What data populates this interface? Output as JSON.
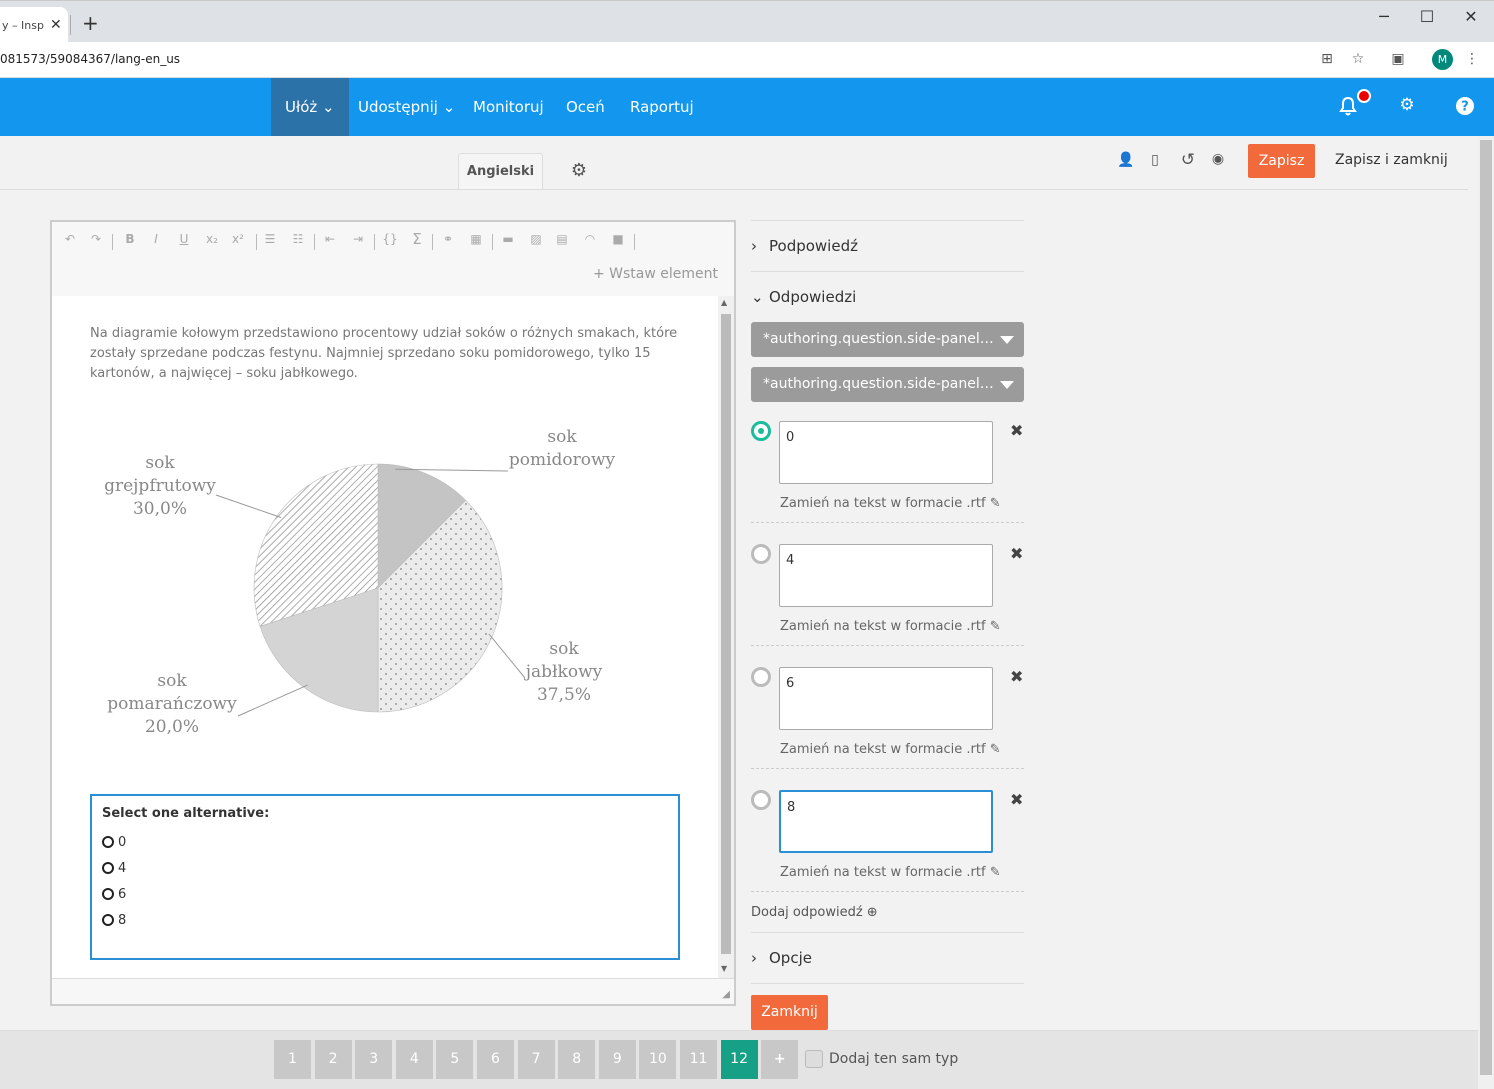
{
  "browser": {
    "tab_title": "y – Inspe",
    "url": "081573/59084367/lang-en_us",
    "avatar_letter": "M"
  },
  "nav": {
    "items": [
      {
        "label": "Ułóż ⌄"
      },
      {
        "label": "Udostępnij ⌄"
      },
      {
        "label": "Monitoruj"
      },
      {
        "label": "Oceń"
      },
      {
        "label": "Raportuj"
      }
    ]
  },
  "toolbar": {
    "language_tab": "Angielski",
    "save_label": "Zapisz",
    "save_close_label": "Zapisz i zamknij"
  },
  "editor": {
    "insert_element": "Wstaw element",
    "question_text": "Na diagramie kołowym przedstawiono procentowy udział soków o różnych smakach, które zostały sprzedane podczas festynu. Najmniej sprzedano soku pomidorowego, tylko 15 kartonów, a najwięcej – soku jabłkowego.",
    "alternatives_title": "Select one alternative:",
    "alternatives": [
      "0",
      "4",
      "6",
      "8"
    ]
  },
  "chart_data": {
    "type": "pie",
    "slices": [
      {
        "label_lines": [
          "sok",
          "pomidorowy"
        ],
        "value": 12.5,
        "pattern": "solid-light-gray"
      },
      {
        "label_lines": [
          "sok",
          "jabłkowy",
          "37,5%"
        ],
        "value": 37.5,
        "pattern": "dotted"
      },
      {
        "label_lines": [
          "sok",
          "pomarańczowy",
          "20,0%"
        ],
        "value": 20.0,
        "pattern": "solid-gray"
      },
      {
        "label_lines": [
          "sok",
          "grejpfrutowy",
          "30,0%"
        ],
        "value": 30.0,
        "pattern": "hatched"
      }
    ]
  },
  "panel": {
    "hint_label": "Podpowiedź",
    "answers_label": "Odpowiedzi",
    "dropdown1": "*authoring.question.side-panel.t...",
    "dropdown2": "*authoring.question.side-panel....",
    "answers": [
      {
        "value": "0",
        "selected": true
      },
      {
        "value": "4",
        "selected": false
      },
      {
        "value": "6",
        "selected": false
      },
      {
        "value": "8",
        "selected": false
      }
    ],
    "rtf_label": "Zamień na tekst w formacie .rtf",
    "add_answer": "Dodaj odpowiedź",
    "options_label": "Opcje",
    "close_label": "Zamknij"
  },
  "pager": {
    "pages": [
      "1",
      "2",
      "3",
      "4",
      "5",
      "6",
      "7",
      "8",
      "9",
      "10",
      "11",
      "12"
    ],
    "active_page": "12",
    "add_symbol": "+",
    "same_type_label": "Dodaj ten sam typ"
  },
  "colors": {
    "nav_blue": "#1296ee",
    "nav_active": "#2a72a8",
    "accent_orange": "#f26a3c",
    "active_green": "#16a085",
    "radio_teal": "#1abc9c"
  }
}
